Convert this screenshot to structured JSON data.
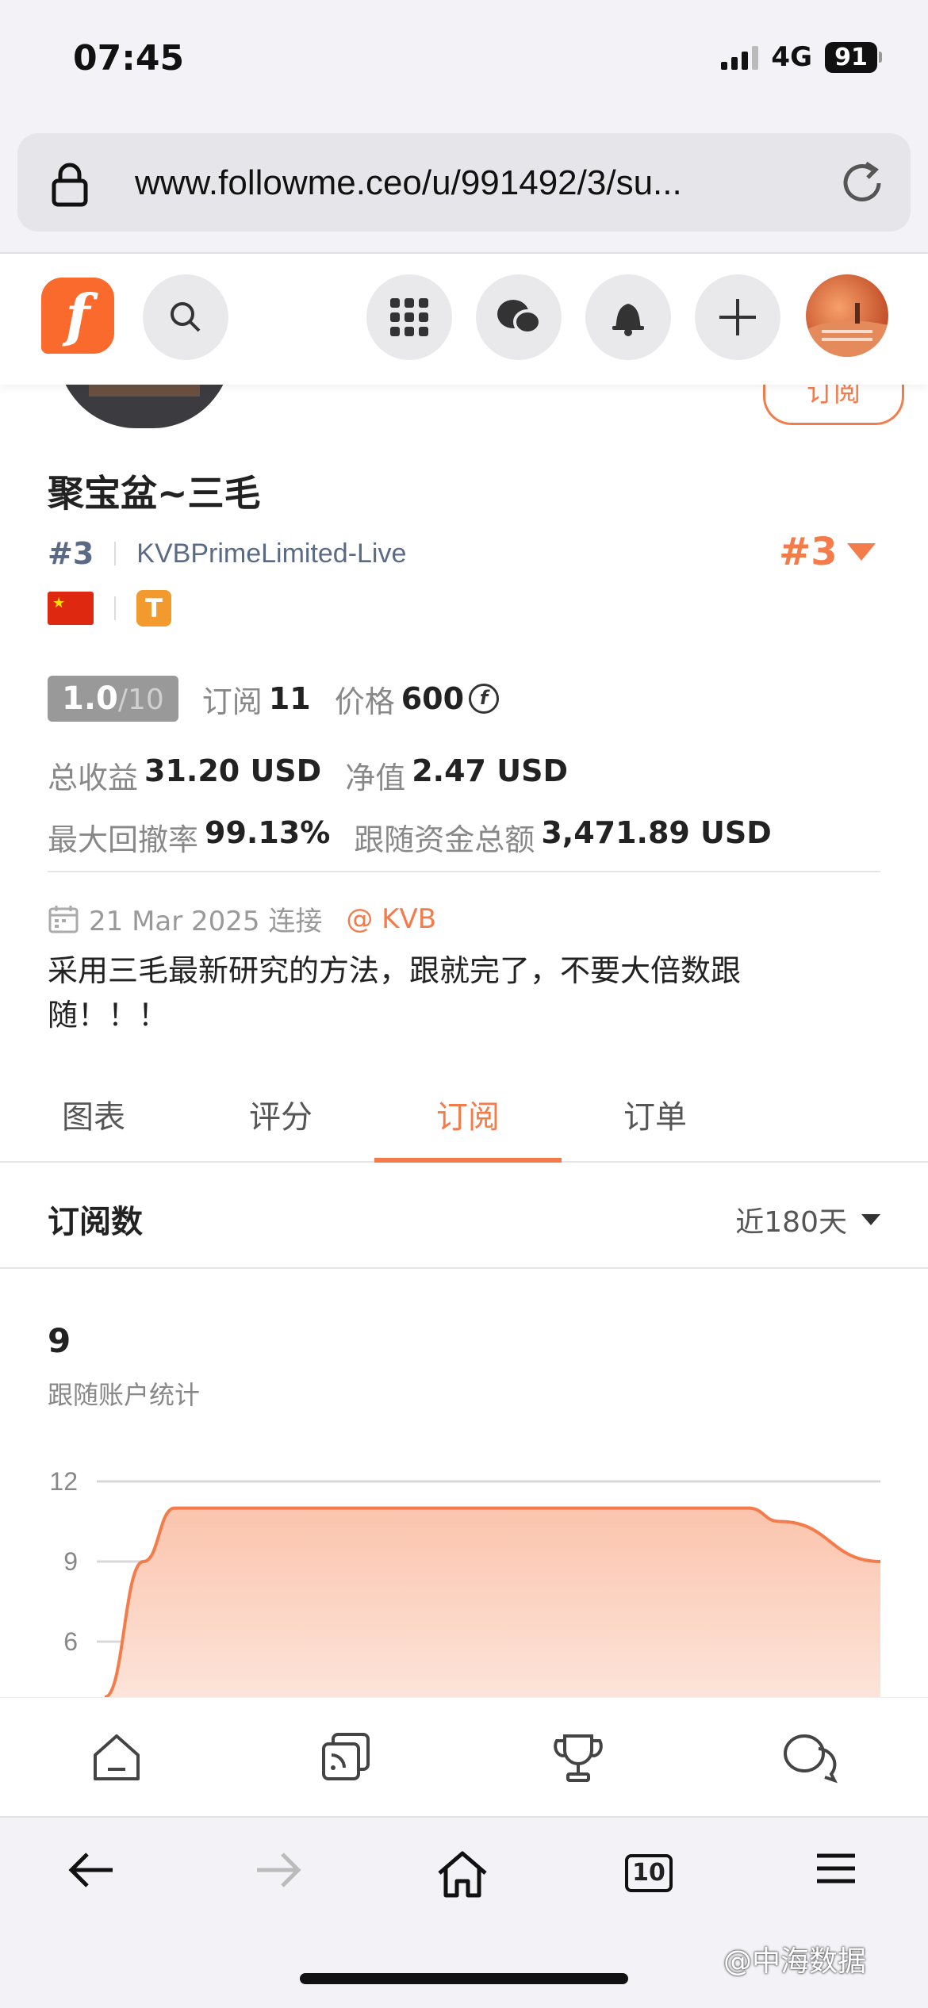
{
  "status_bar": {
    "time": "07:45",
    "network": "4G",
    "battery": "91"
  },
  "browser": {
    "url": "www.followme.ceo/u/991492/3/su...",
    "tab_count": "10"
  },
  "header": {
    "logo_letter": "f"
  },
  "profile": {
    "subscribe_label": "订阅",
    "name": "聚宝盆~三毛",
    "rank": "#3",
    "broker": "KVBPrimeLimited-Live",
    "rank_right": "#3",
    "badge_letter": "T",
    "score": "1.0",
    "score_max": "/10",
    "subs_label": "订阅",
    "subs_value": "11",
    "price_label": "价格",
    "price_value": "600",
    "coin_symbol": "f",
    "profit_label": "总收益",
    "profit_value": "31.20 USD",
    "nav_label": "净值",
    "nav_value": "2.47 USD",
    "drawdown_label": "最大回撤率",
    "drawdown_value": "99.13%",
    "follow_label": "跟随资金总额",
    "follow_value": "3,471.89 USD",
    "date_text": "21 Mar 2025 连接",
    "broker_link": "@ KVB",
    "description": "采用三毛最新研究的方法，跟就完了，不要大倍数跟随！！！"
  },
  "tabs": [
    "图表",
    "评分",
    "订阅",
    "订单"
  ],
  "active_tab": 2,
  "section": {
    "title": "订阅数",
    "range": "近180天"
  },
  "summary": {
    "value": "9",
    "label": "跟随账户统计"
  },
  "chart_data": {
    "type": "area",
    "ylim": [
      3,
      12
    ],
    "yticks": [
      12,
      9,
      6
    ],
    "x": [
      0,
      0.05,
      0.09,
      0.83,
      0.87,
      1.0
    ],
    "values": [
      3,
      9,
      11,
      11,
      10.5,
      9
    ],
    "color": "#f47b4a",
    "fill": "#fbc4ad"
  },
  "footer_nav": [
    "home-icon",
    "feed-icon",
    "trophy-icon",
    "chat-icon"
  ],
  "watermark": "@中海数据"
}
